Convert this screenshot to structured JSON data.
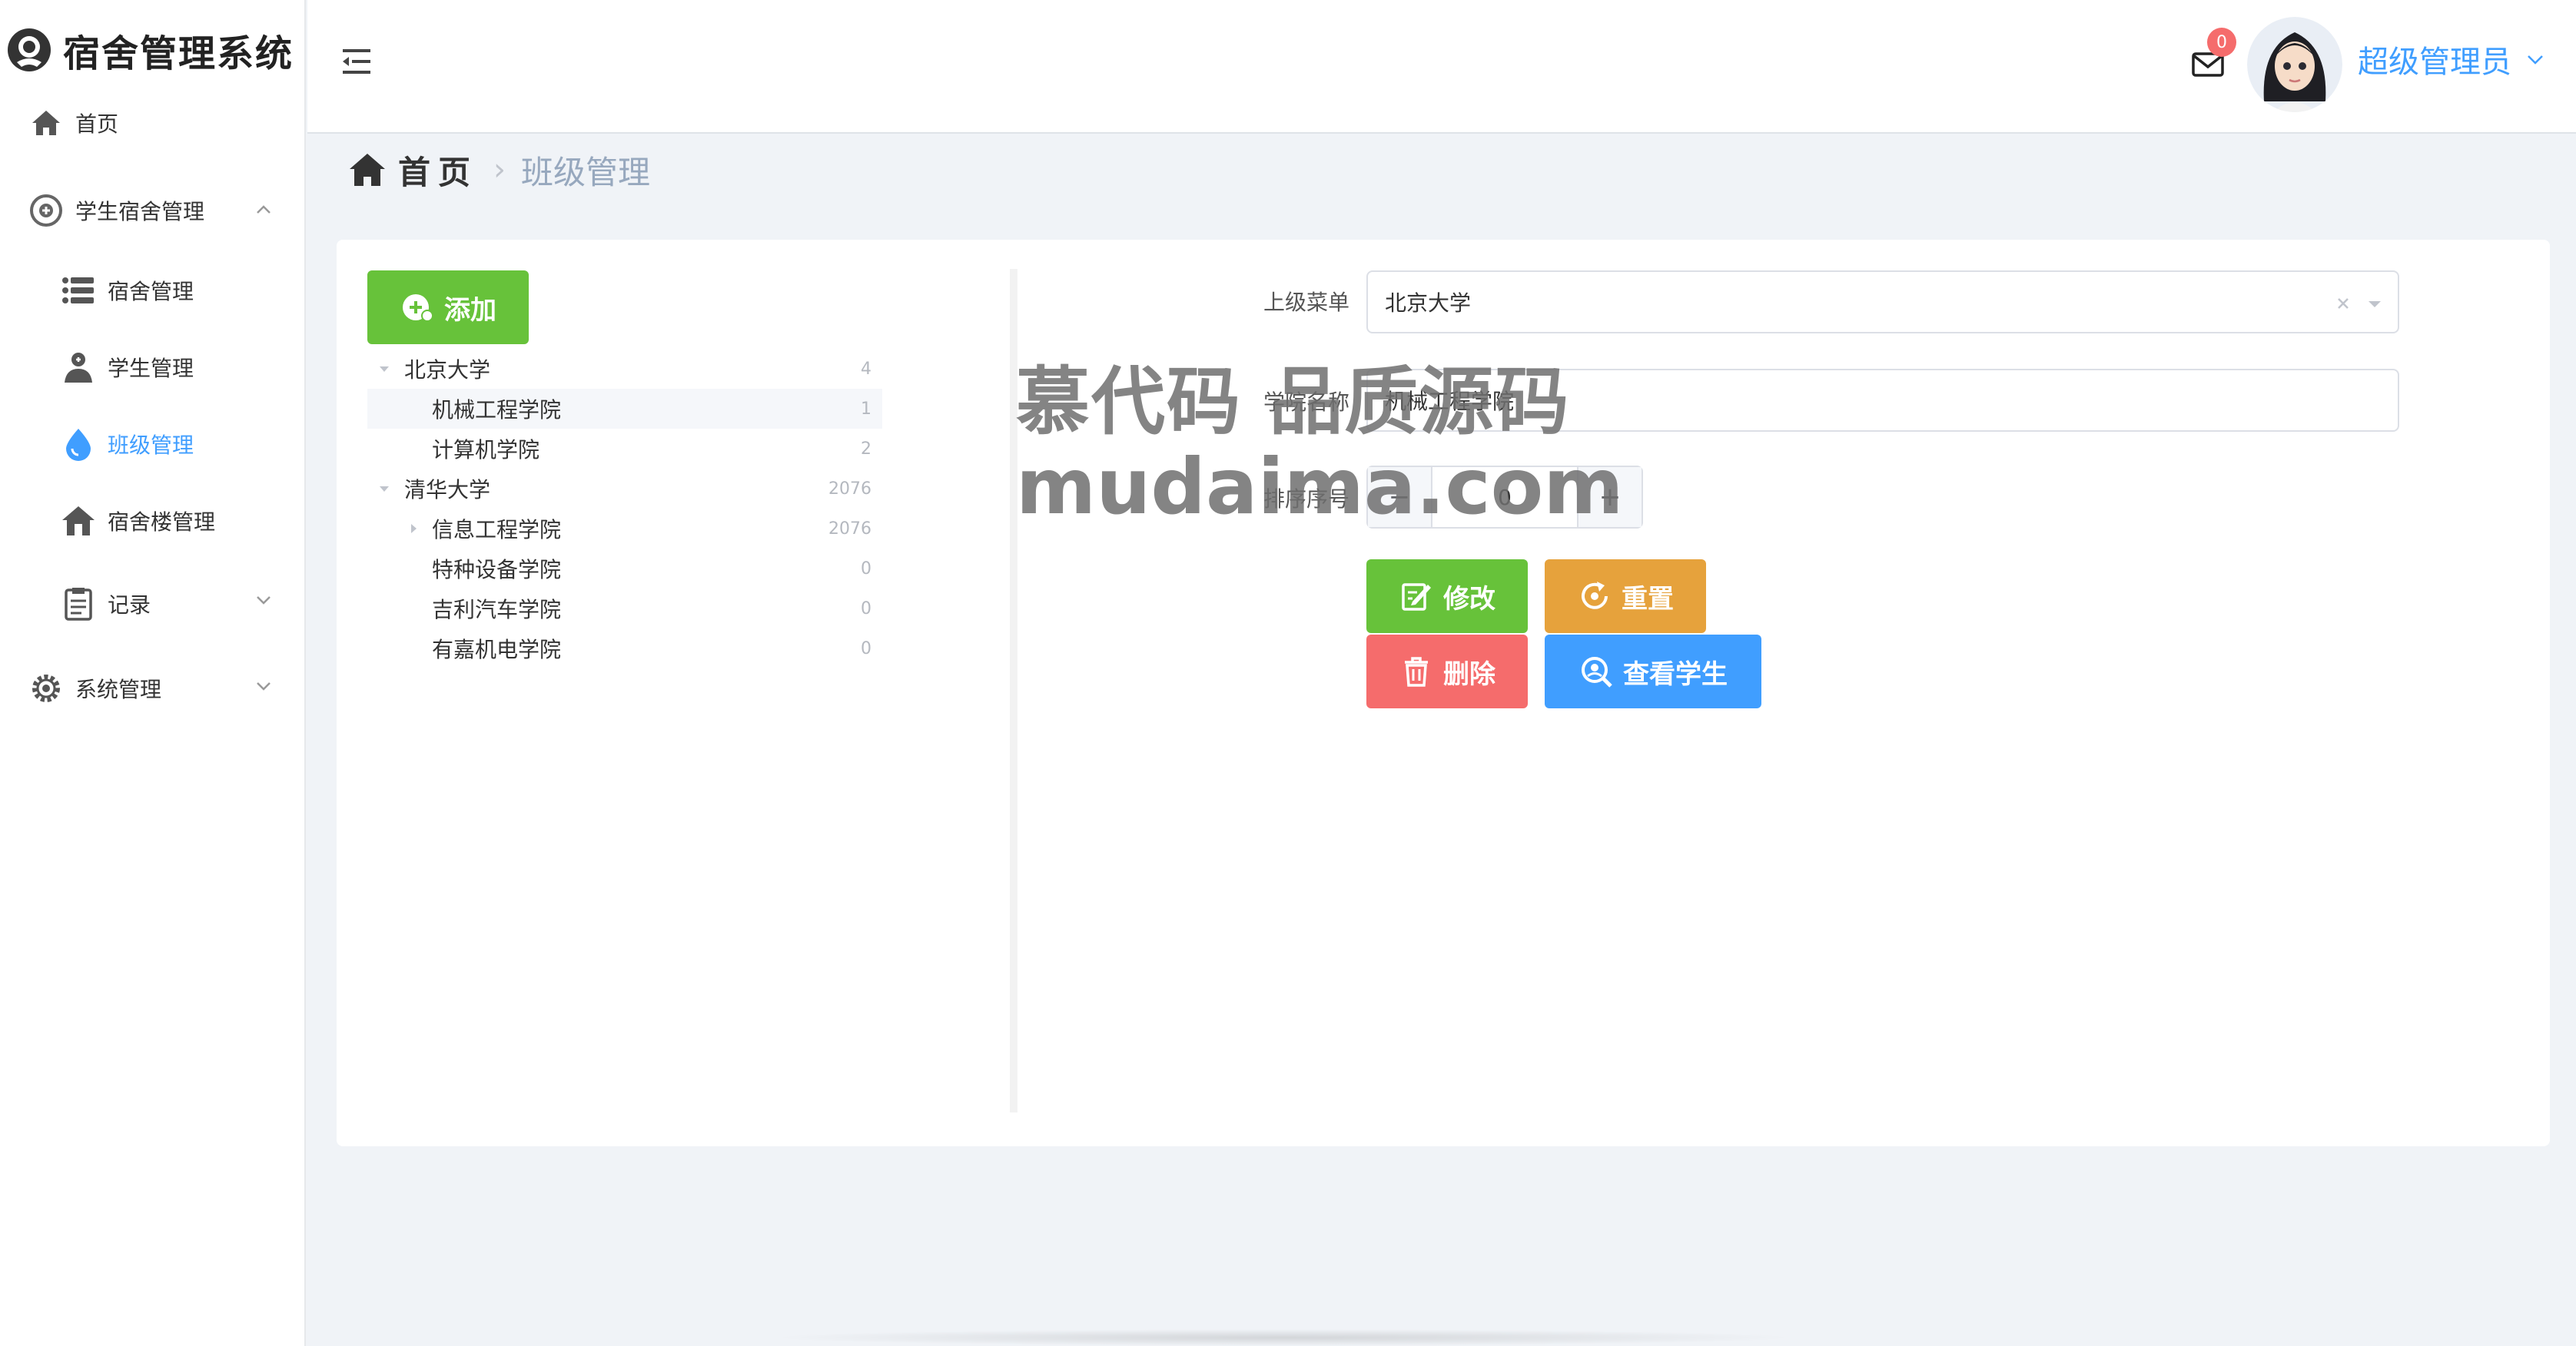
{
  "app": {
    "title": "宿舍管理系统"
  },
  "sidebar": {
    "items": [
      {
        "label": "首页"
      },
      {
        "label": "学生宿舍管理"
      },
      {
        "label": "宿舍管理"
      },
      {
        "label": "学生管理"
      },
      {
        "label": "班级管理"
      },
      {
        "label": "宿舍楼管理"
      },
      {
        "label": "记录"
      },
      {
        "label": "系统管理"
      }
    ],
    "active_color": "#409eff"
  },
  "header": {
    "mail_badge": "0",
    "username": "超级管理员"
  },
  "breadcrumb": {
    "home": "首页",
    "current": "班级管理"
  },
  "toolbar": {
    "add_label": "添加"
  },
  "tree": [
    {
      "label": "北京大学",
      "count": "4"
    },
    {
      "label": "机械工程学院",
      "count": "1"
    },
    {
      "label": "计算机学院",
      "count": "2"
    },
    {
      "label": "清华大学",
      "count": "2076"
    },
    {
      "label": "信息工程学院",
      "count": "2076"
    },
    {
      "label": "特种设备学院",
      "count": "0"
    },
    {
      "label": "吉利汽车学院",
      "count": "0"
    },
    {
      "label": "有嘉机电学院",
      "count": "0"
    }
  ],
  "form": {
    "parent_label": "上级菜单",
    "parent_value": "北京大学",
    "name_label": "学院名称",
    "name_value": "机械工程学院",
    "sort_label": "排序序号",
    "sort_value": "0",
    "edit_label": "修改",
    "reset_label": "重置",
    "delete_label": "删除",
    "view_label": "查看学生"
  },
  "watermark": {
    "line1": "慕代码 品质源码",
    "line2": "mudaima.com"
  },
  "colors": {
    "primary": "#409eff",
    "success": "#67c23a",
    "warning": "#e6a23c",
    "danger": "#f56c6c"
  }
}
